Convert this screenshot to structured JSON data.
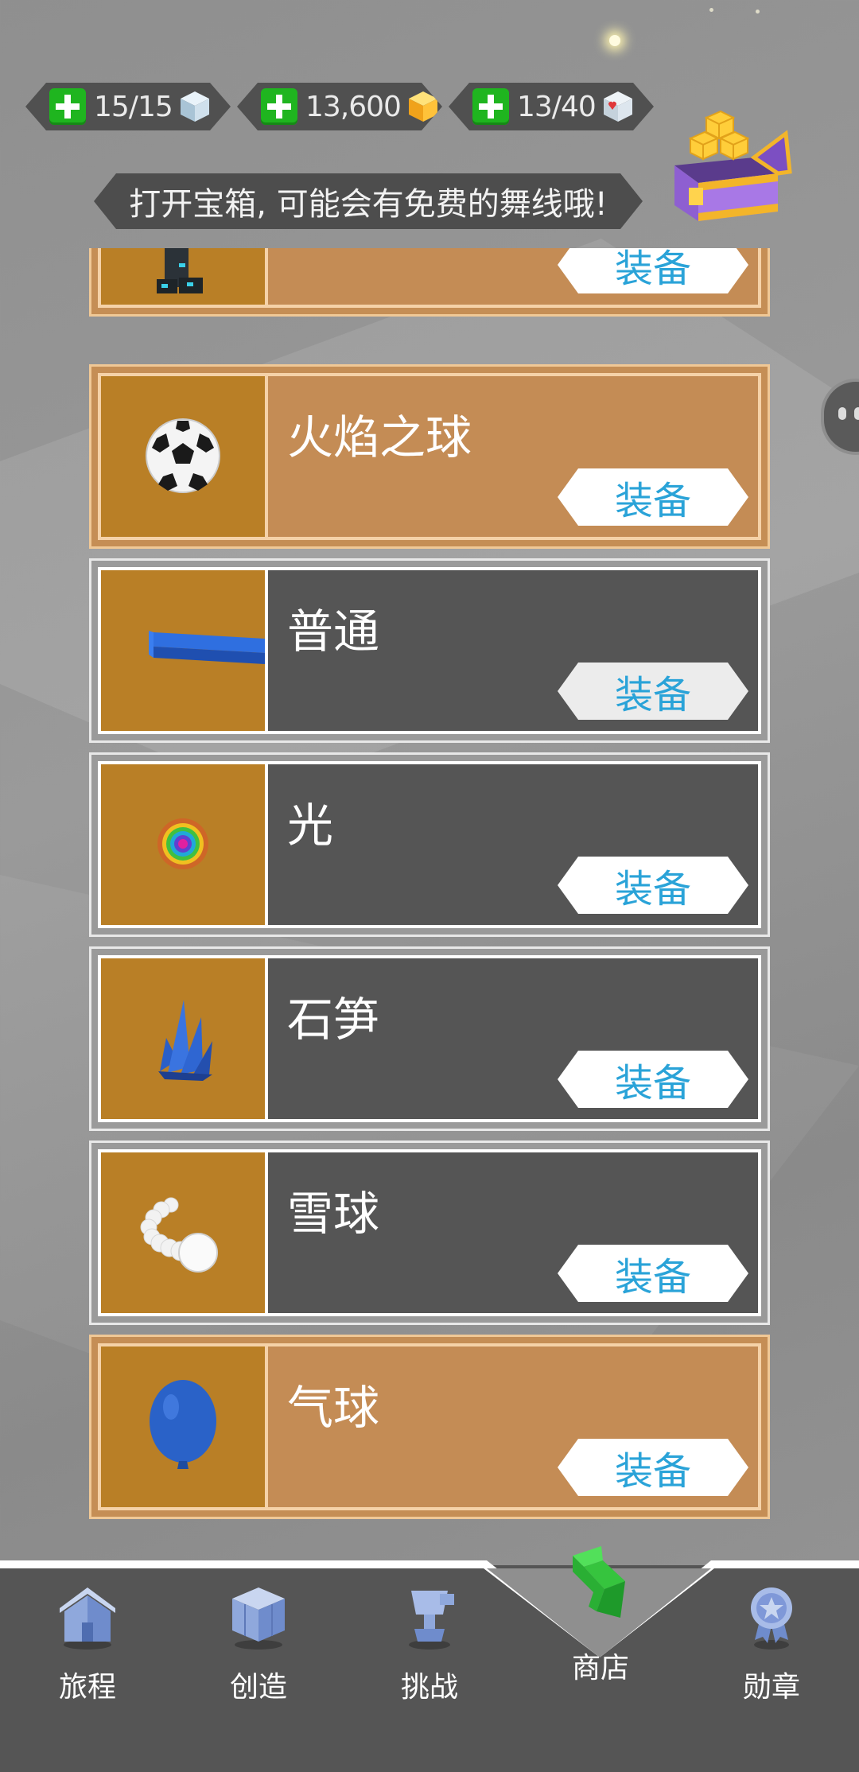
{
  "currencies": [
    {
      "value": "15/15",
      "icon": "ice-cube-icon"
    },
    {
      "value": "13,600",
      "icon": "gold-cube-icon"
    },
    {
      "value": "13/40",
      "icon": "heart-cube-icon"
    }
  ],
  "tip": "打开宝箱, 可能会有免费的舞线哦!",
  "items": [
    {
      "name": "",
      "button": "装备",
      "icon": "robot-icon",
      "style": "gold"
    },
    {
      "name": "火焰之球",
      "button": "装备",
      "icon": "soccer-ball-icon",
      "style": "gold"
    },
    {
      "name": "普通",
      "button": "装备",
      "icon": "blue-line-icon",
      "style": "dark"
    },
    {
      "name": "光",
      "button": "装备",
      "icon": "rainbow-light-icon",
      "style": "dark"
    },
    {
      "name": "石笋",
      "button": "装备",
      "icon": "crystal-icon",
      "style": "dark"
    },
    {
      "name": "雪球",
      "button": "装备",
      "icon": "snowball-icon",
      "style": "dark"
    },
    {
      "name": "气球",
      "button": "装备",
      "icon": "balloon-icon",
      "style": "gold"
    }
  ],
  "nav": [
    {
      "label": "旅程",
      "icon": "house-icon"
    },
    {
      "label": "创造",
      "icon": "cube-build-icon"
    },
    {
      "label": "挑战",
      "icon": "trophy-icon"
    },
    {
      "label": "商店",
      "icon": "shop-bolt-icon"
    },
    {
      "label": "勋章",
      "icon": "medal-icon"
    }
  ]
}
